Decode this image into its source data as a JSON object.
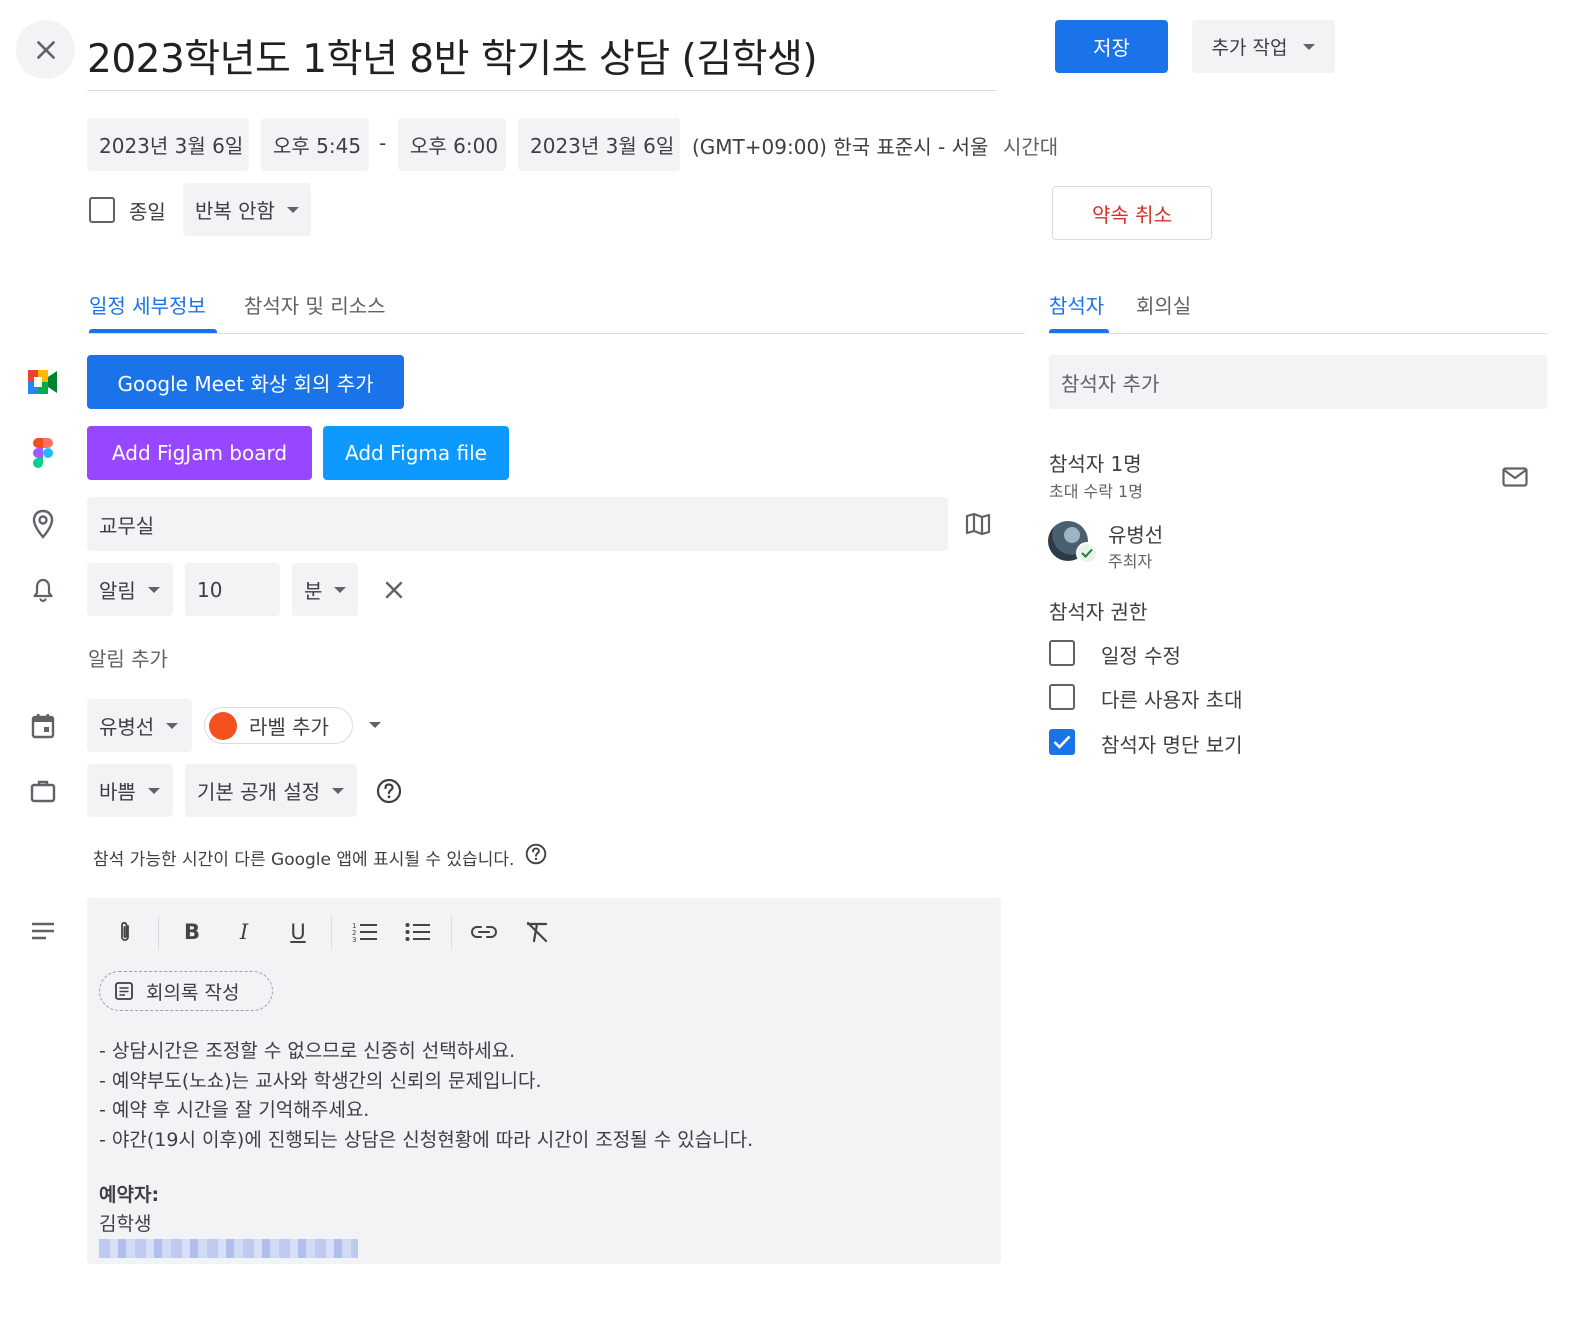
{
  "header": {
    "title": "2023학년도 1학년 8반 학기초 상담 (김학생)",
    "save_label": "저장",
    "more_actions_label": "추가 작업"
  },
  "datetime": {
    "start_date": "2023년 3월 6일",
    "start_time": "오후 5:45",
    "separator": "-",
    "end_time": "오후 6:00",
    "end_date": "2023년 3월 6일",
    "timezone_text": "(GMT+09:00) 한국 표준시 - 서울",
    "timezone_link": "시간대"
  },
  "allday": {
    "label": "종일",
    "repeat_label": "반복 안함"
  },
  "cancel_label": "약속 취소",
  "tabs": {
    "details": "일정 세부정보",
    "attendees_resources": "참석자 및 리소스",
    "guests": "참석자",
    "rooms": "회의실"
  },
  "meet_button": "Google Meet 화상 회의 추가",
  "figjam_button": "Add FigJam board",
  "figma_button": "Add Figma file",
  "location": "교무실",
  "notification": {
    "type": "알림",
    "value": "10",
    "unit": "분",
    "add_label": "알림 추가"
  },
  "calendar": {
    "owner": "유병선",
    "label_add": "라벨 추가",
    "label_color": "#f4511e"
  },
  "availability": {
    "busy": "바쁨",
    "visibility": "기본 공개 설정",
    "note": "참석 가능한 시간이 다른 Google 앱에 표시될 수 있습니다."
  },
  "editor": {
    "notes_button": "회의록 작성",
    "lines": [
      "- 상담시간은 조정할 수 없으므로 신중히 선택하세요.",
      "- 예약부도(노쇼)는 교사와 학생간의 신뢰의 문제입니다.",
      "- 예약 후 시간을 잘 기억해주세요.",
      "- 야간(19시 이후)에 진행되는 상담은 신청현황에 따라 시간이 조정될 수 있습니다."
    ],
    "booker_label": "예약자:",
    "booker_name": "김학생"
  },
  "guests": {
    "add_placeholder": "참석자 추가",
    "count": "참석자 1명",
    "accepted": "초대 수락 1명",
    "person_name": "유병선",
    "person_role": "주최자",
    "permissions_title": "참석자 권한",
    "perm_modify": "일정 수정",
    "perm_invite": "다른 사용자 초대",
    "perm_see_list": "참석자 명단 보기"
  },
  "colors": {
    "accent": "#1a73e8",
    "figjam": "#9747ff",
    "figma": "#0d99ff",
    "cancel": "#d93025"
  }
}
